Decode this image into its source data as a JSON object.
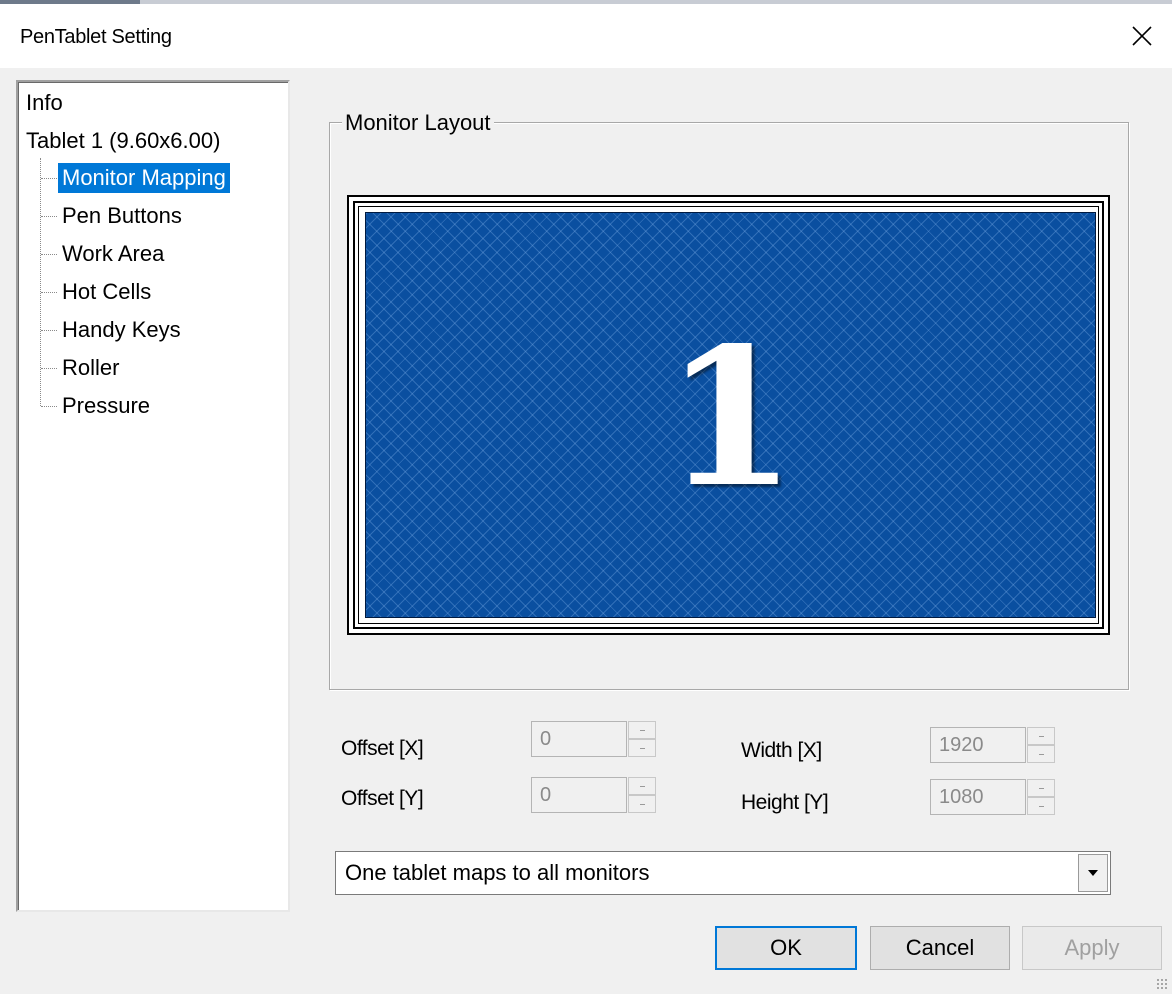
{
  "window": {
    "title": "PenTablet Setting",
    "close_label": "×"
  },
  "tree": {
    "root_items": [
      {
        "label": "Info"
      },
      {
        "label": "Tablet  1 (9.60x6.00)"
      }
    ],
    "children": [
      {
        "label": "Monitor Mapping",
        "selected": true
      },
      {
        "label": "Pen Buttons",
        "selected": false
      },
      {
        "label": "Work Area",
        "selected": false
      },
      {
        "label": "Hot Cells",
        "selected": false
      },
      {
        "label": "Handy Keys",
        "selected": false
      },
      {
        "label": "Roller",
        "selected": false
      },
      {
        "label": "Pressure",
        "selected": false
      }
    ]
  },
  "monitor_layout": {
    "group_label": "Monitor Layout",
    "monitor_number": "1",
    "screen_color": "#0a4fa0"
  },
  "fields": {
    "offset_x": {
      "label": "Offset [X]",
      "value": "0"
    },
    "offset_y": {
      "label": "Offset [Y]",
      "value": "0"
    },
    "width_x": {
      "label": "Width [X]",
      "value": "1920"
    },
    "height_y": {
      "label": "Height [Y]",
      "value": "1080"
    }
  },
  "mapping_mode": {
    "selected": "One tablet maps to all monitors"
  },
  "buttons": {
    "ok": "OK",
    "cancel": "Cancel",
    "apply": "Apply"
  },
  "colors": {
    "accent": "#0078d7"
  }
}
